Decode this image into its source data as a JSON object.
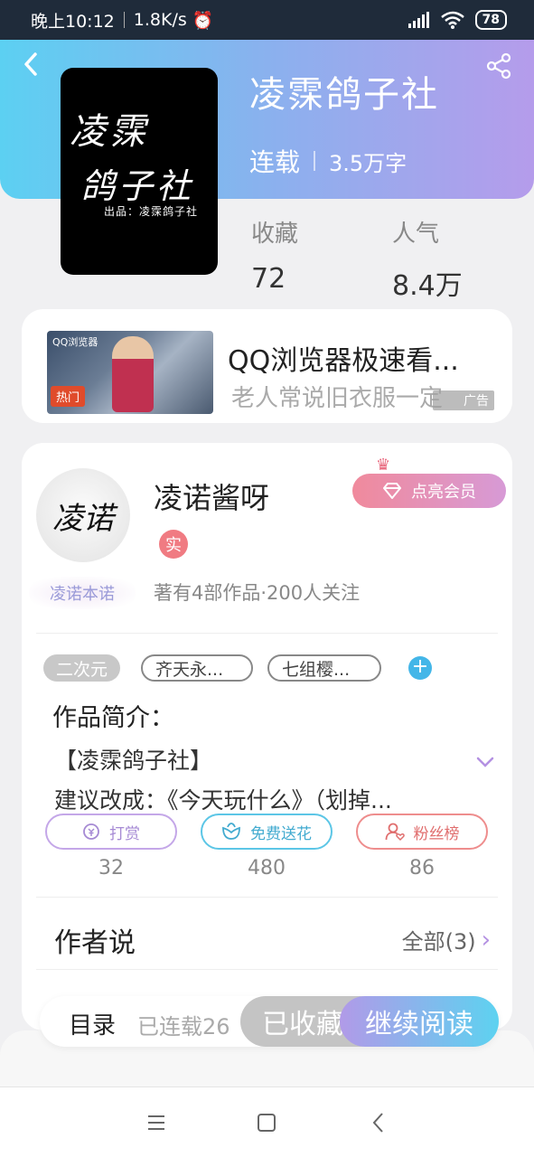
{
  "status_bar": {
    "time": "晚上10:12",
    "speed": "1.8K/s",
    "battery": "78"
  },
  "book": {
    "title": "凌霂鸽子社",
    "status": "连载",
    "word_count": "3.5万字",
    "cover": {
      "line1": "凌霂",
      "line2": "鸽子社",
      "line3": "出品：凌霂鸽子社"
    },
    "stats": [
      {
        "label": "收藏",
        "value": "72"
      },
      {
        "label": "人气",
        "value": "8.4万"
      }
    ]
  },
  "ad": {
    "title": "QQ浏览器极速看...",
    "description": "老人常说旧衣服一定",
    "label": "广告",
    "thumb_badge": "热门",
    "thumb_brand": "QQ浏览器"
  },
  "author": {
    "avatar_text": "凌诺",
    "name": "凌诺酱呀",
    "verified_label": "实",
    "vip_button": "点亮会员",
    "nickname_badge": "凌诺本诺",
    "stats": "著有4部作品·200人关注"
  },
  "tags": [
    "二次元",
    "齐天永...",
    "七组樱..."
  ],
  "intro": {
    "heading": "作品简介：",
    "line1": "【凌霂鸽子社】",
    "line2": "建议改成：《今天玩什么》（划掉..."
  },
  "actions": [
    {
      "label": "打赏",
      "count": "32",
      "icon": "coin-icon",
      "color": "#a68ad4"
    },
    {
      "label": "免费送花",
      "count": "480",
      "icon": "flower-icon",
      "color": "#43abd0"
    },
    {
      "label": "粉丝榜",
      "count": "86",
      "icon": "fans-icon",
      "color": "#e06e6e"
    }
  ],
  "author_say": {
    "heading": "作者说",
    "all_link": "全部(3)"
  },
  "bottom_bar": {
    "catalog": "目录",
    "serial": "已连载26",
    "collected": "已收藏",
    "continue": "继续阅读"
  },
  "colors": {
    "accent": "#b491e2",
    "gradient_start": "#5cd0f2",
    "gradient_end": "#b59ceb"
  }
}
